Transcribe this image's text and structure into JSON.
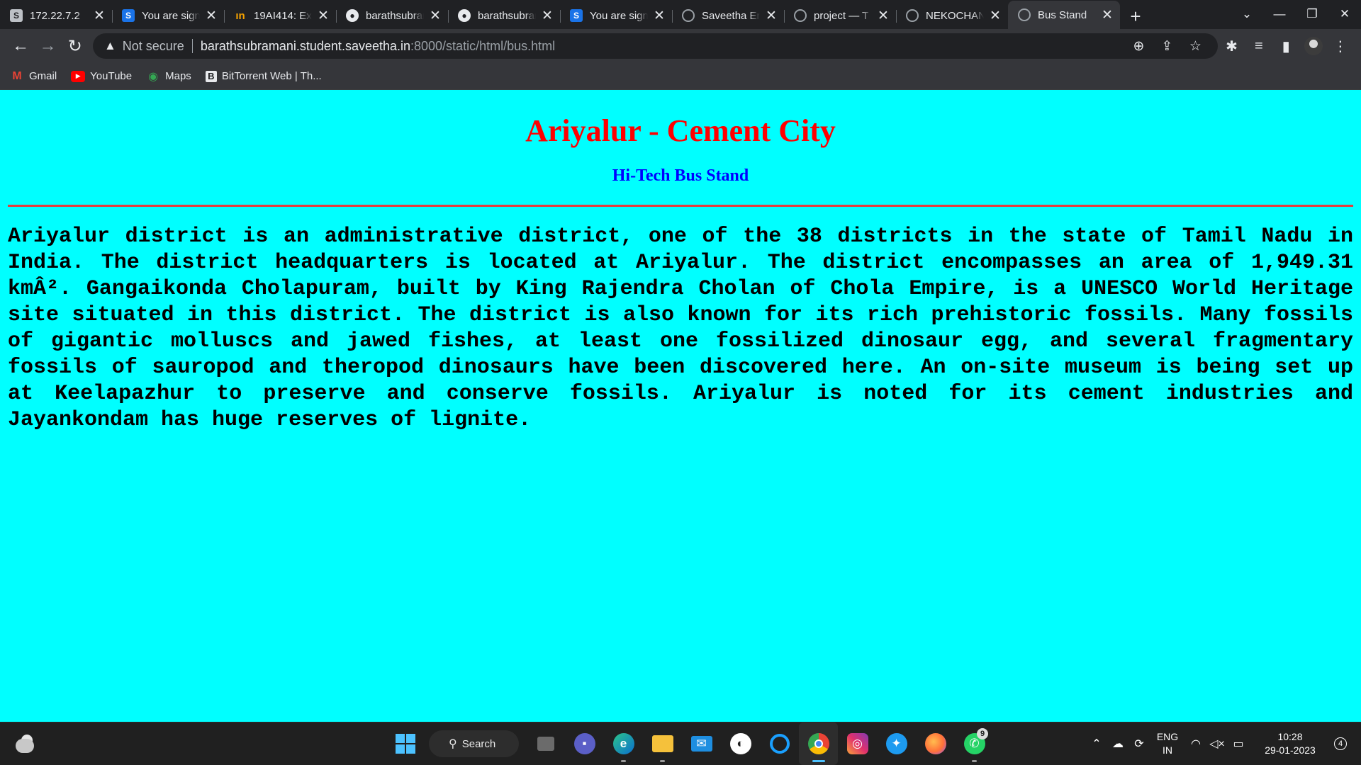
{
  "browser": {
    "tabs": [
      {
        "title": "172.22.7.2",
        "favicon": "s-grey-icon"
      },
      {
        "title": "You are signed in",
        "favicon": "s-blue-icon"
      },
      {
        "title": "19AI414: Ex",
        "favicon": "in-icon"
      },
      {
        "title": "barathsubramani",
        "favicon": "github-icon"
      },
      {
        "title": "barathsubramani",
        "favicon": "github-icon"
      },
      {
        "title": "You are signed in",
        "favicon": "s-blue-icon"
      },
      {
        "title": "Saveetha Engineering",
        "favicon": "globe-icon"
      },
      {
        "title": "project — T",
        "favicon": "globe-icon"
      },
      {
        "title": "NEKOCHAN",
        "favicon": "globe-icon"
      },
      {
        "title": "Bus Stand",
        "favicon": "globe-icon",
        "active": true
      }
    ],
    "address": {
      "security_label": "Not secure",
      "host": "barathsubramani.student.saveetha.in",
      "path": ":8000/static/html/bus.html"
    },
    "bookmarks": [
      {
        "label": "Gmail",
        "icon": "gmail-icon"
      },
      {
        "label": "YouTube",
        "icon": "youtube-icon"
      },
      {
        "label": "Maps",
        "icon": "maps-icon"
      },
      {
        "label": "BitTorrent Web | Th...",
        "icon": "bittorrent-icon"
      }
    ]
  },
  "page": {
    "background": "#00ffff",
    "title": "Ariyalur - Cement City",
    "title_color": "#ff0000",
    "subtitle": "Hi-Tech Bus Stand",
    "subtitle_color": "#0000ff",
    "rule_color": "#e63c3c",
    "body": "Ariyalur district is an administrative district, one of the 38 districts in the state of Tamil Nadu in India. The district headquarters is located at Ariyalur. The district encompasses an area of 1,949.31 kmÂ². Gangaikonda Cholapuram, built by King Rajendra Cholan of Chola Empire, is a UNESCO World Heritage site situated in this district. The district is also known for its rich prehistoric fossils. Many fossils of gigantic molluscs and jawed fishes, at least one fossilized dinosaur egg, and several fragmentary fossils of sauropod and theropod dinosaurs have been discovered here. An on-site museum is being set up at Keelapazhur to preserve and conserve fossils. Ariyalur is noted for its cement industries and Jayankondam has huge reserves of lignite."
  },
  "taskbar": {
    "search_label": "Search",
    "whatsapp_badge": "9",
    "language": "ENG",
    "region": "IN",
    "time": "10:28",
    "date": "29-01-2023",
    "notification_count": "4"
  }
}
